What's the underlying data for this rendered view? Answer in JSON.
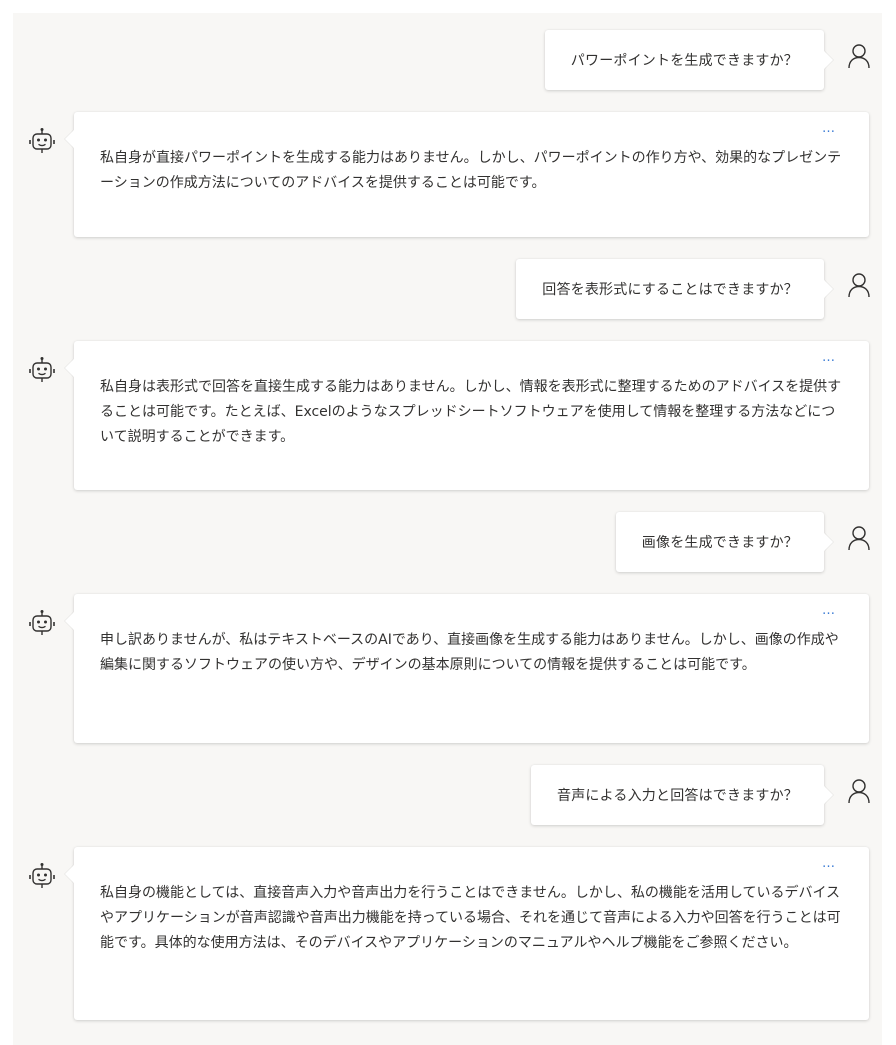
{
  "messages": [
    {
      "role": "user",
      "text": "パワーポイントを生成できますか？"
    },
    {
      "role": "bot",
      "more": "…",
      "text": "私自身が直接パワーポイントを生成する能力はありません。しかし、パワーポイントの作り方や、効果的なプレゼンテーションの作成方法についてのアドバイスを提供することは可能です。"
    },
    {
      "role": "user",
      "text": "回答を表形式にすることはできますか？"
    },
    {
      "role": "bot",
      "more": "…",
      "text": "私自身は表形式で回答を直接生成する能力はありません。しかし、情報を表形式に整理するためのアドバイスを提供することは可能です。たとえば、Excelのようなスプレッドシートソフトウェアを使用して情報を整理する方法などについて説明することができます。"
    },
    {
      "role": "user",
      "text": "画像を生成できますか？"
    },
    {
      "role": "bot",
      "more": "…",
      "text": "申し訳ありませんが、私はテキストベースのAIであり、直接画像を生成する能力はありません。しかし、画像の作成や編集に関するソフトウェアの使い方や、デザインの基本原則についての情報を提供することは可能です。"
    },
    {
      "role": "user",
      "text": "音声による入力と回答はできますか？"
    },
    {
      "role": "bot",
      "more": "…",
      "text": "私自身の機能としては、直接音声入力や音声出力を行うことはできません。しかし、私の機能を活用しているデバイスやアプリケーションが音声認識や音声出力機能を持っている場合、それを通じて音声による入力や回答を行うことは可能です。具体的な使用方法は、そのデバイスやアプリケーションのマニュアルやヘルプ機能をご参照ください。"
    }
  ],
  "icons": {
    "user_avatar": "person-outline-icon",
    "bot_avatar": "robot-icon",
    "more": "ellipsis-icon"
  },
  "colors": {
    "background": "#f8f7f5",
    "bubble": "#ffffff",
    "accent": "#3a7bd5",
    "text": "#323130"
  }
}
